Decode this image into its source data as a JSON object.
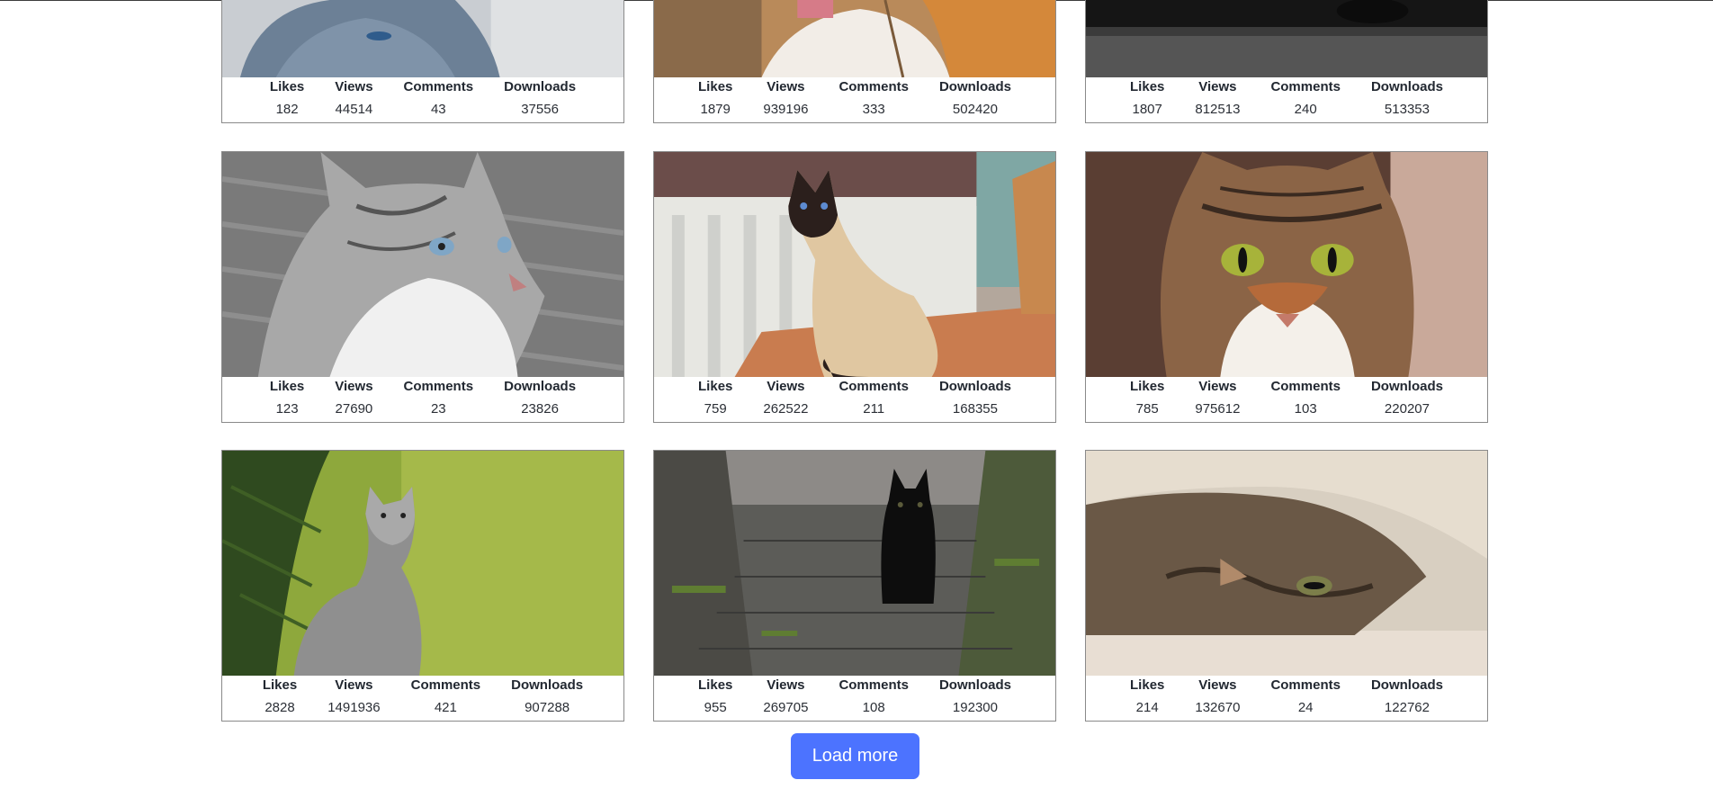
{
  "stat_labels": {
    "likes": "Likes",
    "views": "Views",
    "comments": "Comments",
    "downloads": "Downloads"
  },
  "cards": [
    {
      "subject": "gray cat with blue collar",
      "likes": "182",
      "views": "44514",
      "comments": "43",
      "downloads": "37556"
    },
    {
      "subject": "white and orange cat",
      "likes": "1879",
      "views": "939196",
      "comments": "333",
      "downloads": "502420"
    },
    {
      "subject": "dark cat on gray surface",
      "likes": "1807",
      "views": "812513",
      "comments": "240",
      "downloads": "513353"
    },
    {
      "subject": "gray and white tabby cat looking up",
      "likes": "123",
      "views": "27690",
      "comments": "23",
      "downloads": "23826"
    },
    {
      "subject": "siamese cat on table",
      "likes": "759",
      "views": "262522",
      "comments": "211",
      "downloads": "168355"
    },
    {
      "subject": "tabby cat with green eyes",
      "likes": "785",
      "views": "975612",
      "comments": "103",
      "downloads": "220207"
    },
    {
      "subject": "kitten sitting by pine tree",
      "likes": "2828",
      "views": "1491936",
      "comments": "421",
      "downloads": "907288"
    },
    {
      "subject": "black kitten on brick path",
      "likes": "955",
      "views": "269705",
      "comments": "108",
      "downloads": "192300"
    },
    {
      "subject": "tabby cat under blanket",
      "likes": "214",
      "views": "132670",
      "comments": "24",
      "downloads": "122762"
    }
  ],
  "load_more_label": "Load more",
  "colors": {
    "button": "#4c73ff",
    "card_border": "#8a8a8a",
    "stat_text": "#222831"
  }
}
